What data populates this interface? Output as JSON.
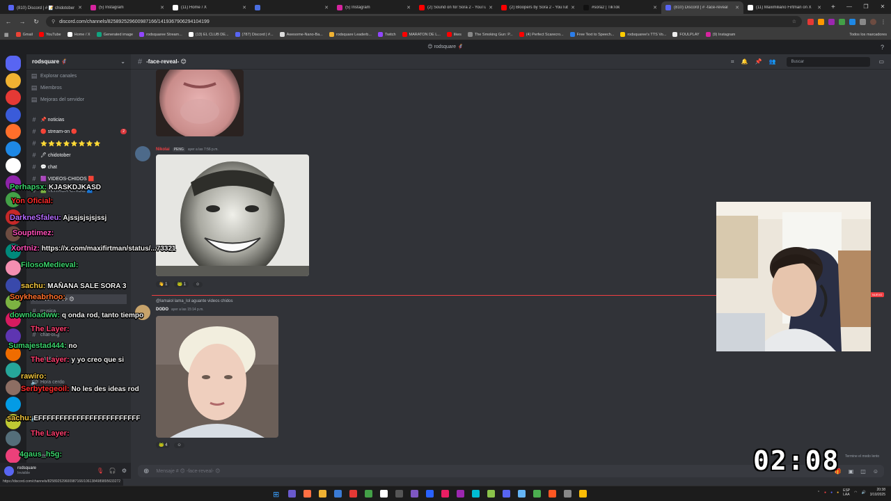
{
  "browser": {
    "tabs": [
      {
        "title": "(810) Discord | # 📝 chidotober",
        "color": "#5865f2"
      },
      {
        "title": "(5) Instagram",
        "color": "#d6249f"
      },
      {
        "title": "(11) Home / X",
        "color": "#ffffff"
      },
      {
        "title": "",
        "color": "#4a6ee0"
      },
      {
        "title": "(5) Instagram",
        "color": "#d6249f"
      },
      {
        "title": "(2) Sound on for Sora 2 - YouTube",
        "color": "#ff0000"
      },
      {
        "title": "(2) Bloopers by Sora 2 - YouTube",
        "color": "#ff0000"
      },
      {
        "title": "#sora2 | TikTok",
        "color": "#111111"
      },
      {
        "title": "(810) Discord | # -face-reveal",
        "color": "#5865f2"
      },
      {
        "title": "(11) Maximiliano Firtman on X",
        "color": "#ffffff"
      }
    ],
    "active_tab": 8,
    "url": "discord.com/channels/825892529600987166/1419367906294104199",
    "bookmarks": [
      {
        "label": "Gmail",
        "color": "#ea4335"
      },
      {
        "label": "YouTube",
        "color": "#ff0000"
      },
      {
        "label": "Home / X",
        "color": "#ffffff"
      },
      {
        "label": "Generated image",
        "color": "#10a37f"
      },
      {
        "label": "rodsquaree Stream...",
        "color": "#9146ff"
      },
      {
        "label": "(13) EL CLUB DE...",
        "color": "#ffffff"
      },
      {
        "label": "(787) Discord | #...",
        "color": "#5865f2"
      },
      {
        "label": "Awesome-Nano-Ba...",
        "color": "#dddddd"
      },
      {
        "label": "rodsquare Leaderb...",
        "color": "#f0b232"
      },
      {
        "label": "Twitch",
        "color": "#9146ff"
      },
      {
        "label": "MARATON DE L...",
        "color": "#ff0000"
      },
      {
        "label": "likes",
        "color": "#ff0000"
      },
      {
        "label": "The Smoking Gun: P...",
        "color": "#888888"
      },
      {
        "label": "(4) Perfect Scarecro...",
        "color": "#ff0000"
      },
      {
        "label": "Free Text to Speech...",
        "color": "#2b7de9"
      },
      {
        "label": "rodsquaree's TTS Vo...",
        "color": "#ffcc00"
      },
      {
        "label": "FOULPLAY",
        "color": "#eeeeee"
      },
      {
        "label": "(9) Instagram",
        "color": "#d6249f"
      }
    ],
    "bookmarks_right": "Todos los marcadores",
    "status_url": "https://discord.com/channels/825892529600987166/1061384989895633272"
  },
  "discord": {
    "title_bar": "😊 rodsquare 🦸",
    "server_name": "rodsquare 🦸",
    "channels": [
      {
        "label": "Explorar canales",
        "type": "nav"
      },
      {
        "label": "Miembros",
        "type": "nav"
      },
      {
        "label": "Mejoras del servidor",
        "type": "nav"
      },
      {
        "label": "📌 noticias",
        "type": "text"
      },
      {
        "label": "🔴 stream-on 🔴",
        "type": "text",
        "badge": "2"
      },
      {
        "label": "⭐⭐⭐⭐⭐⭐⭐⭐",
        "type": "text"
      },
      {
        "label": "🖊 chidotober",
        "type": "text"
      },
      {
        "label": "💬 chat",
        "type": "text"
      },
      {
        "label": "🟪 VIDEOS-CHIDOS 🟥",
        "type": "text"
      },
      {
        "label": "🟩 TERROR-CHIDO 🟦",
        "type": "text"
      },
      {
        "label": "-face-reveal- 😊",
        "type": "text",
        "selected": true
      },
      {
        "label": "musica",
        "type": "text"
      },
      {
        "label": "chat-ong",
        "type": "text"
      },
      {
        "label": "mascotas",
        "type": "text"
      },
      {
        "label": "garlic-phone",
        "type": "text"
      },
      {
        "label": "Hora cerdo",
        "type": "voice"
      },
      {
        "label": "charla lol 2",
        "type": "voice"
      },
      {
        "label": "medal",
        "type": "text"
      }
    ],
    "channel_name": "-face-reveal- 😊",
    "search_placeholder": "Buscar",
    "messages": [
      {
        "user": "Nikolai",
        "tag": "PENG",
        "time": "ayer a las 7:56 p.m.",
        "reactions": [
          "👋 1",
          "🐸 1"
        ]
      },
      {
        "reply_to": "@lamaiol lama_lol aguante videos chidos",
        "user": "DODO",
        "time": "ayer a las 15:14 p.m.",
        "reactions": [
          "🐸 4"
        ]
      }
    ],
    "new_label": "NUEVO",
    "composer_placeholder": "Mensaje # 😊 -face-reveal- 😊",
    "user": {
      "name": "rodsquare",
      "status": "Invisible"
    },
    "slow_mode_note": "Termine el modo lento"
  },
  "chat_overlay": [
    {
      "user": "Perhapsx:",
      "msg": "KJASKDJKASD",
      "color": "#3ad16b"
    },
    {
      "user": "Yon Oficial:",
      "msg": "",
      "color": "#ff2b2b"
    },
    {
      "user": "DarkneSfaleu:",
      "msg": "Ajssjsjsjsjssj",
      "color": "#b56bff"
    },
    {
      "user": "Souptimez:",
      "msg": "",
      "color": "#ff4fb8"
    },
    {
      "user": "Xortniz:",
      "msg": "https://x.com/maxifirtman/status/...73321",
      "color": "#ff4fb8"
    },
    {
      "user": "FilosoMedieval:",
      "msg": "",
      "color": "#3ad16b"
    },
    {
      "user": "sachu:",
      "msg": "MAÑANA SALE SORA 3",
      "color": "#f0c43c"
    },
    {
      "user": "Soykheabrhoo:",
      "msg": "",
      "color": "#ff6f2b"
    },
    {
      "user": "downloadww:",
      "msg": "q onda rod, tanto tiempo",
      "color": "#3ad16b"
    },
    {
      "user": "The Layer:",
      "msg": "",
      "color": "#ff3f6f"
    },
    {
      "user": "Sumajestad444:",
      "msg": "no",
      "color": "#3ad16b"
    },
    {
      "user": "The Layer:",
      "msg": "y yo creo que si",
      "color": "#ff3f6f"
    },
    {
      "user": "rawiro:",
      "msg": "",
      "color": "#f0c43c"
    },
    {
      "user": "Serbytegeoil:",
      "msg": "No les des ideas rod",
      "color": "#ff2b2b"
    },
    {
      "user": "sachu:",
      "msg": "EFFFFFFFFFFFFFFFFFFFFFFFF",
      "color": "#f0c43c"
    },
    {
      "user": "The Layer:",
      "msg": "",
      "color": "#ff3f6f"
    },
    {
      "user": "4gaus_h5g:",
      "msg": "",
      "color": "#3ad16b"
    }
  ],
  "timer": "02:08",
  "taskbar": {
    "lang": "ESP\nLAA",
    "time": "20:38",
    "date": "3/10/2025"
  }
}
